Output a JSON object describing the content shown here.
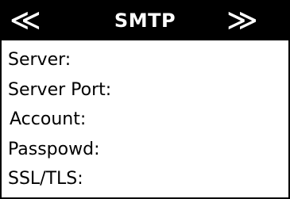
{
  "header": {
    "prev_label": "≪",
    "title": "SMTP",
    "next_label": "≫"
  },
  "fields": [
    {
      "label": "Server:"
    },
    {
      "label": "Server Port:"
    },
    {
      "label": "Account:"
    },
    {
      "label": "Passpowd:"
    },
    {
      "label": "SSL/TLS:"
    }
  ],
  "colors": {
    "header_bg": "#000000",
    "header_text": "#ffffff",
    "body_bg": "#ffffff",
    "text": "#000000"
  }
}
